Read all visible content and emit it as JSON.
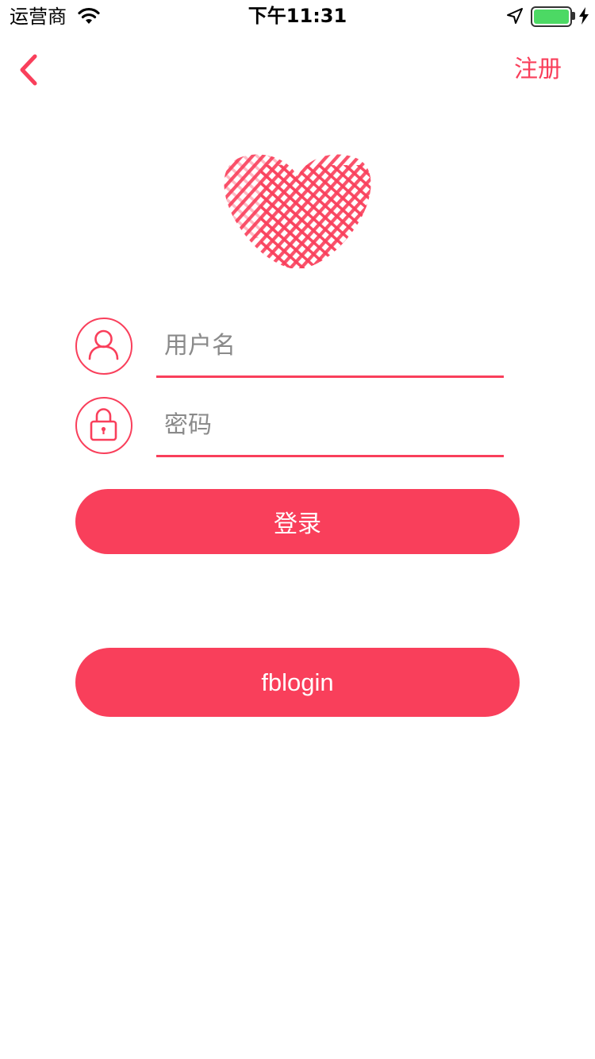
{
  "status_bar": {
    "carrier": "运营商",
    "time": "下午11:31",
    "battery_level": 1.0
  },
  "nav": {
    "back_icon": "chevron-left-icon",
    "register_label": "注册"
  },
  "logo": {
    "icon": "heart-logo"
  },
  "form": {
    "username": {
      "icon": "user-icon",
      "placeholder": "用户名",
      "value": ""
    },
    "password": {
      "icon": "lock-icon",
      "placeholder": "密码",
      "value": ""
    }
  },
  "buttons": {
    "login_label": "登录",
    "fb_login_label": "fblogin"
  },
  "colors": {
    "accent": "#f93f5b",
    "battery": "#4cd964"
  }
}
